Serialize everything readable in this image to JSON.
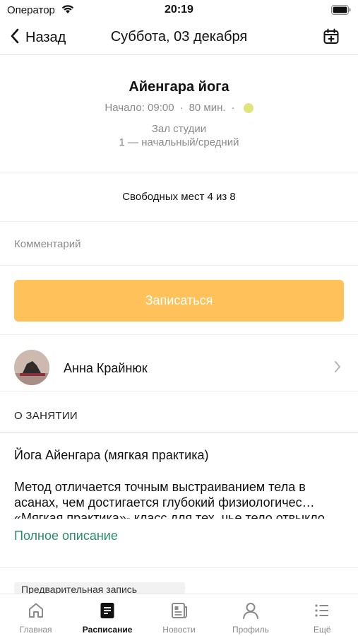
{
  "status_bar": {
    "carrier": "Оператор",
    "time": "20:19"
  },
  "nav": {
    "back_label": "Назад",
    "title": "Суббота, 03 декабря"
  },
  "class": {
    "name": "Айенгара йога",
    "start": "Начало: 09:00",
    "duration": "80 мин.",
    "separator": "·",
    "level_color": "#dfe57a",
    "hall": "Зал студии",
    "level": "1 — начальный/средний"
  },
  "spots": "Свободных мест 4 из 8",
  "comment": {
    "placeholder": "Комментарий",
    "value": ""
  },
  "signup_button": "Записаться",
  "trainer": {
    "name": "Анна Крайнюк"
  },
  "section_title": "О ЗАНЯТИИ",
  "description": {
    "title": "Йога Айенгара (мягкая практика)",
    "text": "Метод отличается точным выстраиванием тела в асанах, чем достигается глубокий физиологичес… «Мягкая практика»- класс для тех, чье тело отвыкло",
    "more": "Полное описание"
  },
  "prebook": "Предварительная запись",
  "tabs": [
    {
      "label": "Главная",
      "icon": "home-icon",
      "active": false
    },
    {
      "label": "Расписание",
      "icon": "schedule-icon",
      "active": true
    },
    {
      "label": "Новости",
      "icon": "news-icon",
      "active": false
    },
    {
      "label": "Профиль",
      "icon": "profile-icon",
      "active": false
    },
    {
      "label": "Ещё",
      "icon": "more-icon",
      "active": false
    }
  ],
  "colors": {
    "accent_button": "#ffc25b",
    "link": "#2a8a6c"
  }
}
